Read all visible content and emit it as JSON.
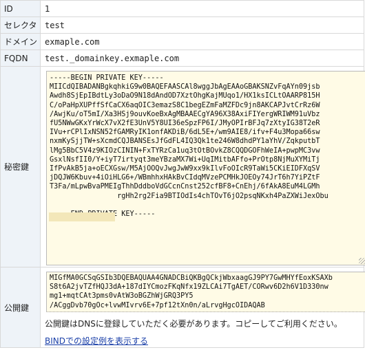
{
  "rows": {
    "id": {
      "label": "ID",
      "value": "1"
    },
    "selector": {
      "label": "セレクタ",
      "value": "test"
    },
    "domain": {
      "label": "ドメイン",
      "value": "exmaple.com"
    },
    "fqdn": {
      "label": "FQDN",
      "value": "test._domainkey.exmaple.com"
    }
  },
  "private_key": {
    "label": "秘密鍵",
    "lines": [
      "-----BEGIN PRIVATE KEY-----",
      "MIICdQIBADANBgkqhkiG9w0BAQEFAASCAl8wggJbAgEAAoGBAKSNZvFqAYn09jsb",
      "Awdh8SjEpIBdtLy3oDaO9N18dAndOD7XztOhgKajMUqo1/HX1ksICLtOAARP815H",
      "C/oPaHpXUPffSfCaCX6aqOIC3emazS8C1begEZmFaMZFDc9jn8AKCAPJvtCrRz6W",
      "/AwjKu/oT5mI/Xa3HSj9ouvKoeBxAgMBAAECgYA96X38AxiFIYergWRIWM91uVbz",
      "fU5NWwGKxYrWcX7vX2fE3UnV5Y8UI36eSpzFP6I/JMyOPIrBFJq7zXtyIG38T2eR",
      "IVu+rCPlIxNSN52fGAMRyIK1onfAKDiB/6dL5E+/wm9AIE8/ifv+F4u3Mopa66sw",
      "nxmKySjjTW+sXcmdCQJBANSEsJfGdFL4IQ3Qk1te246W8dhdPY1aYhV/ZqkputbT",
      "lMg5BbC5V4z9KIOzCININ+FxTYRzCa1uq3tOtBOvkZ8CQQDGOFhWeIA+pwpMC3vw",
      "GsxlNsfII0/Y+iyT7irtyqt3meYBzaMX7Wi+UqIMitbAFfo+PrOtp8NjMuXYMiTj",
      "IfPvAkB5ja+oECXGsw/M5AjOOQvJwgJwW9xx9kIlvFoOIcR9TaWi5CKiEIDFXqSV",
      "jDQJW6Kbuv+4iOiHLG6+/WBmhhxHAkBvCIdqMVzePCMHkJOEOy74JrT6h7YiPZtF",
      "T3Fa/mLpwBvaPMEIgThhDddboVdGCcnCnst252cfBF8+CnEhj/6fAkA8EuM4LGMh",
      "                rgHh2rg2Fia9BTIOdIs4chTOvT6jO2psqNKxh4PaZXWiJexObu",
      "",
      "-----END PRIVATE KEY-----"
    ]
  },
  "public_key": {
    "label": "公開鍵",
    "lines": [
      "MIGfMA0GCSqGSIb3DQEBAQUAA4GNADCBiQKBgQCkjWbxaagGJ9PY7GwMHYfEoxKSAXb",
      "S8t6A2jvTZfHQJ3dA+187dIYCmozFKqNfx19ZLCAi7TgAET/CORwv6D2h6V1D330nw",
      "mg1+mqtCAt3pms0vAtW3oBGZhWjGRQ3PY5",
      "/ACggDvb70gOc+lvwMIvrv6E+7pf12tXn0n/aLrvgHgcOIDAQAB"
    ],
    "note": "公開鍵はDNSに登録していただく必要があります。コピーしてご利用ください。",
    "link": "BINDでの設定例を表示する"
  }
}
